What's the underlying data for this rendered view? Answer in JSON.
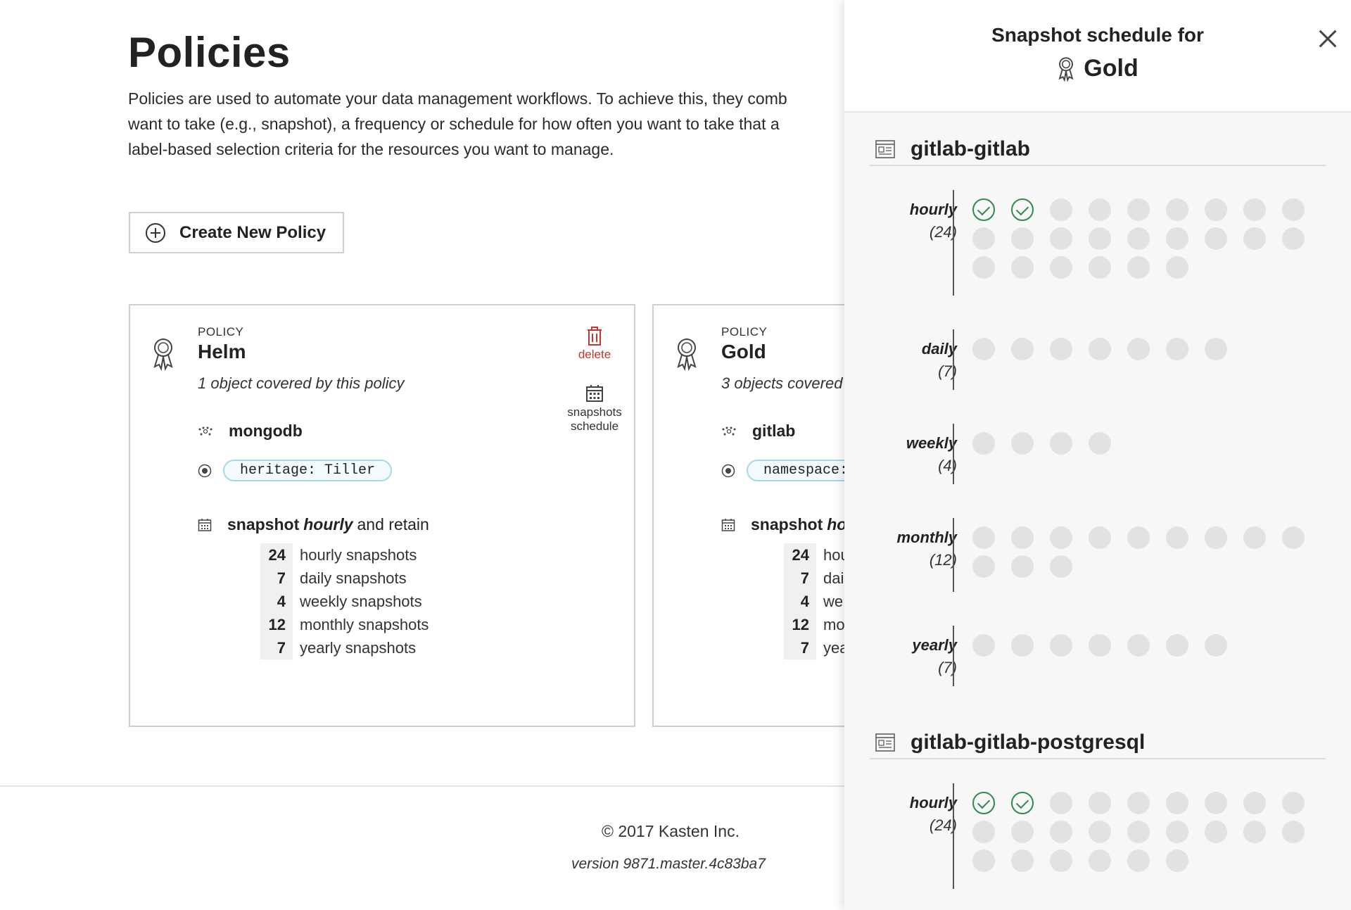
{
  "page": {
    "title": "Policies",
    "description": "Policies are used to automate your data management workflows. To achieve this, they comb want to take (e.g., snapshot), a frequency or schedule for how often you want to take that a label-based selection criteria for the resources you want to manage.",
    "description_lines": [
      "Policies are used to automate your data management workflows. To achieve this, they comb",
      "want to take (e.g., snapshot), a frequency or schedule for how often you want to take that a",
      "label-based selection criteria for the resources you want to manage."
    ],
    "create_button_label": "Create New Policy"
  },
  "policies": [
    {
      "kicker": "POLICY",
      "name": "Helm",
      "covered": "1 object covered by this policy",
      "app": "mongodb",
      "label": "heritage: Tiller",
      "schedule_prefix": "snapshot",
      "schedule_freq": "hourly",
      "schedule_suffix": "and retain",
      "retention": [
        {
          "num": "24",
          "text": "hourly snapshots"
        },
        {
          "num": "7",
          "text": "daily snapshots"
        },
        {
          "num": "4",
          "text": "weekly snapshots"
        },
        {
          "num": "12",
          "text": "monthly snapshots"
        },
        {
          "num": "7",
          "text": "yearly snapshots"
        }
      ],
      "delete_label": "delete",
      "schedule_btn_line1": "snapshots",
      "schedule_btn_line2": "schedule"
    },
    {
      "kicker": "POLICY",
      "name": "Gold",
      "covered": "3 objects covered",
      "app": "gitlab",
      "label": "namespace:",
      "schedule_prefix": "snapshot",
      "schedule_freq": "ho",
      "retention": [
        {
          "num": "24",
          "text": "hou"
        },
        {
          "num": "7",
          "text": "dai"
        },
        {
          "num": "4",
          "text": "we"
        },
        {
          "num": "12",
          "text": "mo"
        },
        {
          "num": "7",
          "text": "yea"
        }
      ]
    }
  ],
  "footer": {
    "copyright": "© 2017 Kasten Inc.",
    "version": "version 9871.master.4c83ba7"
  },
  "drawer": {
    "title_line1": "Snapshot schedule for",
    "policy_name": "Gold",
    "objects": [
      {
        "name": "gitlab-gitlab",
        "frequencies": [
          {
            "name": "hourly",
            "count": "(24)",
            "total": 24,
            "done": 2
          },
          {
            "name": "daily",
            "count": "(7)",
            "total": 7,
            "done": 0
          },
          {
            "name": "weekly",
            "count": "(4)",
            "total": 4,
            "done": 0
          },
          {
            "name": "monthly",
            "count": "(12)",
            "total": 12,
            "done": 0
          },
          {
            "name": "yearly",
            "count": "(7)",
            "total": 7,
            "done": 0
          }
        ]
      },
      {
        "name": "gitlab-gitlab-postgresql",
        "frequencies": [
          {
            "name": "hourly",
            "count": "(24)",
            "total": 24,
            "done": 2
          }
        ]
      }
    ]
  }
}
